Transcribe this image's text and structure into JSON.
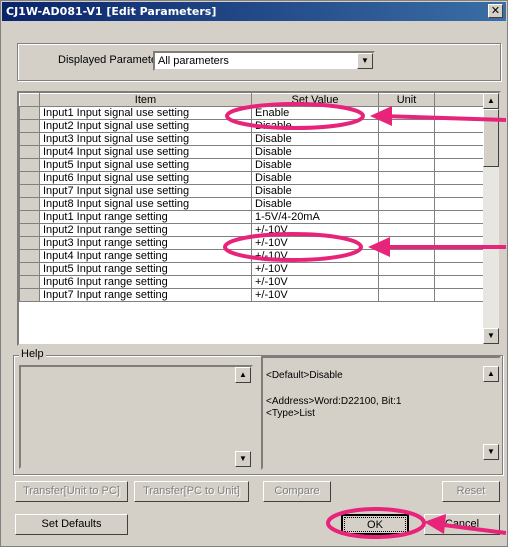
{
  "window": {
    "title": "CJ1W-AD081-V1 [Edit Parameters]",
    "close_glyph": "✕"
  },
  "displayed": {
    "label": "Displayed Parameter",
    "value": "All parameters"
  },
  "table": {
    "headers": [
      "Item",
      "Set Value",
      "Unit"
    ],
    "rows": [
      {
        "item": "Input1 Input signal use setting",
        "value": "Enable"
      },
      {
        "item": "Input2 Input signal use setting",
        "value": "Disable"
      },
      {
        "item": "Input3 Input signal use setting",
        "value": "Disable"
      },
      {
        "item": "Input4 Input signal use setting",
        "value": "Disable"
      },
      {
        "item": "Input5 Input signal use setting",
        "value": "Disable"
      },
      {
        "item": "Input6 Input signal use setting",
        "value": "Disable"
      },
      {
        "item": "Input7 Input signal use setting",
        "value": "Disable"
      },
      {
        "item": "Input8 Input signal use setting",
        "value": "Disable"
      },
      {
        "item": "Input1 Input range setting",
        "value": "1-5V/4-20mA"
      },
      {
        "item": "Input2 Input range setting",
        "value": "+/-10V"
      },
      {
        "item": "Input3 Input range setting",
        "value": "+/-10V"
      },
      {
        "item": "Input4 Input range setting",
        "value": "+/-10V"
      },
      {
        "item": "Input5 Input range setting",
        "value": "+/-10V"
      },
      {
        "item": "Input6 Input range setting",
        "value": "+/-10V"
      },
      {
        "item": "Input7 Input range setting",
        "value": "+/-10V"
      }
    ]
  },
  "help": {
    "label": "Help",
    "default_line": "<Default>Disable",
    "address_line": "<Address>Word:D22100, Bit:1",
    "type_line": "<Type>List"
  },
  "buttons": {
    "transfer_unit_to_pc": "Transfer[Unit to PC]",
    "transfer_pc_to_unit": "Transfer[PC to Unit]",
    "compare": "Compare",
    "reset": "Reset",
    "set_defaults": "Set Defaults",
    "ok": "OK",
    "cancel": "Cancel"
  },
  "colors": {
    "annotation": "#e8247a",
    "title_bar": "#0a246a"
  }
}
